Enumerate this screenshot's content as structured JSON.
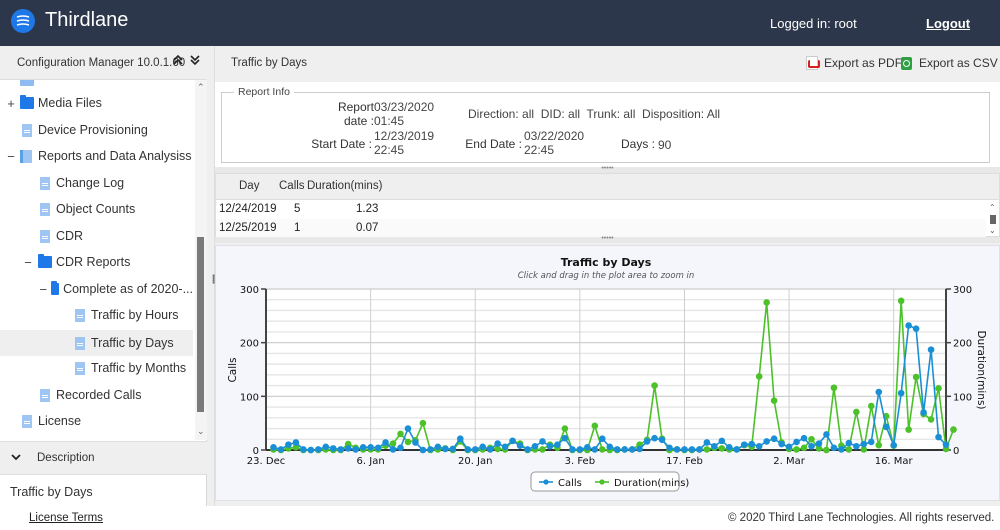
{
  "header": {
    "brand": "Thirdlane",
    "logged_in": "Logged in: root",
    "logout": "Logout"
  },
  "left_panel": {
    "title": "Configuration Manager 10.0.1.60",
    "collapse_up": "»",
    "collapse_down": "»",
    "tree": [
      {
        "label": "Media Files",
        "toggle": "+",
        "icon": "folder-icon",
        "level": 0
      },
      {
        "label": "Device Provisioning",
        "toggle": "",
        "icon": "document-icon",
        "level": 0
      },
      {
        "label": "Reports and Data Analysiss",
        "toggle": "−",
        "icon": "documents-icon",
        "level": 0
      },
      {
        "label": "Change Log",
        "toggle": "",
        "icon": "document-icon",
        "level": 1
      },
      {
        "label": "Object Counts",
        "toggle": "",
        "icon": "document-icon",
        "level": 1
      },
      {
        "label": "CDR",
        "toggle": "",
        "icon": "document-icon",
        "level": 1
      },
      {
        "label": "CDR Reports",
        "toggle": "−",
        "icon": "folder-icon",
        "level": 1
      },
      {
        "label": "Complete as of 2020-...",
        "toggle": "−",
        "icon": "folder-icon",
        "level": 2
      },
      {
        "label": "Traffic by Hours",
        "toggle": "",
        "icon": "document-icon",
        "level": 3
      },
      {
        "label": "Traffic by Days",
        "toggle": "",
        "icon": "document-icon",
        "level": 3,
        "selected": true
      },
      {
        "label": "Traffic by Months",
        "toggle": "",
        "icon": "document-icon",
        "level": 3
      },
      {
        "label": "Recorded Calls",
        "toggle": "",
        "icon": "document-icon",
        "level": 1
      },
      {
        "label": "License",
        "toggle": "",
        "icon": "document-icon",
        "level": 0
      }
    ],
    "description_title": "Description",
    "description_text": "Traffic by Days"
  },
  "main": {
    "title": "Traffic by Days",
    "export_pdf": "Export as PDF",
    "export_csv": "Export as CSV",
    "report_info": {
      "legend": "Report Info",
      "report_date_label_1": "Report",
      "report_date_label_2": "date :",
      "report_date_1": "03/23/2020",
      "report_date_2": "01:45",
      "filters": "Direction: all  DID: all  Trunk: all  Disposition: All",
      "start_label": "Start Date :",
      "start_1": "12/23/2019",
      "start_2": "22:45",
      "end_label": "End Date :",
      "end_1": "03/22/2020",
      "end_2": "22:45",
      "days_label": "Days :",
      "days_value": "90"
    },
    "grid": {
      "columns": [
        "Day",
        "Calls",
        "Duration(mins)"
      ],
      "rows": [
        [
          "12/24/2019",
          "5",
          "1.23"
        ],
        [
          "12/25/2019",
          "1",
          "0.07"
        ]
      ]
    }
  },
  "chart_data": {
    "type": "line",
    "title": "Traffic by Days",
    "subtitle": "Click and drag in the plot area to zoom in",
    "xlabel": "",
    "ylabel": "Calls",
    "y2label": "Duration(mins)",
    "ylim": [
      0,
      300
    ],
    "y2lim": [
      0,
      300
    ],
    "yticks": [
      0,
      100,
      200,
      300
    ],
    "y2ticks": [
      0,
      100,
      200,
      300
    ],
    "xticks": [
      "23. Dec",
      "6. Jan",
      "20. Jan",
      "3. Feb",
      "17. Feb",
      "2. Mar",
      "16. Mar"
    ],
    "x_start": "2019-12-24",
    "grid": true,
    "legend": "bottom-center",
    "series": [
      {
        "name": "Calls",
        "color": "#1b8fd6",
        "values": [
          5,
          1,
          10,
          14,
          1,
          0,
          1,
          6,
          3,
          1,
          3,
          1,
          5,
          5,
          4,
          14,
          1,
          4,
          40,
          14,
          0,
          1,
          6,
          2,
          2,
          21,
          1,
          1,
          6,
          1,
          12,
          6,
          17,
          8,
          1,
          7,
          16,
          7,
          10,
          22,
          1,
          1,
          5,
          1,
          21,
          6,
          1,
          1,
          1,
          2,
          16,
          22,
          19,
          4,
          1,
          1,
          1,
          1,
          14,
          7,
          17,
          5,
          1,
          10,
          11,
          7,
          16,
          21,
          11,
          6,
          15,
          22,
          7,
          12,
          29,
          4,
          1,
          13,
          7,
          11,
          15,
          108,
          43,
          9,
          106,
          232,
          226,
          70,
          187,
          24,
          10
        ]
      },
      {
        "name": "Duration(mins)",
        "color": "#4cc12a",
        "values": [
          1,
          0,
          3,
          5,
          0,
          0,
          0,
          1,
          0,
          0,
          11,
          4,
          1,
          1,
          1,
          8,
          12,
          30,
          15,
          18,
          50,
          0,
          1,
          3,
          0,
          16,
          0,
          0,
          1,
          4,
          2,
          1,
          17,
          12,
          0,
          1,
          1,
          10,
          4,
          40,
          0,
          0,
          0,
          45,
          1,
          0,
          0,
          1,
          1,
          10,
          19,
          120,
          21,
          0,
          1,
          0,
          0,
          1,
          1,
          4,
          3,
          1,
          1,
          9,
          6,
          137,
          275,
          92,
          14,
          2,
          1,
          4,
          20,
          3,
          0,
          116,
          8,
          1,
          71,
          1,
          82,
          9,
          63,
          8,
          278,
          38,
          136,
          67,
          57,
          115,
          2,
          38
        ]
      }
    ]
  },
  "footer": {
    "license": "License Terms",
    "copyright": "© 2020 Third Lane Technologies. All rights reserved."
  }
}
